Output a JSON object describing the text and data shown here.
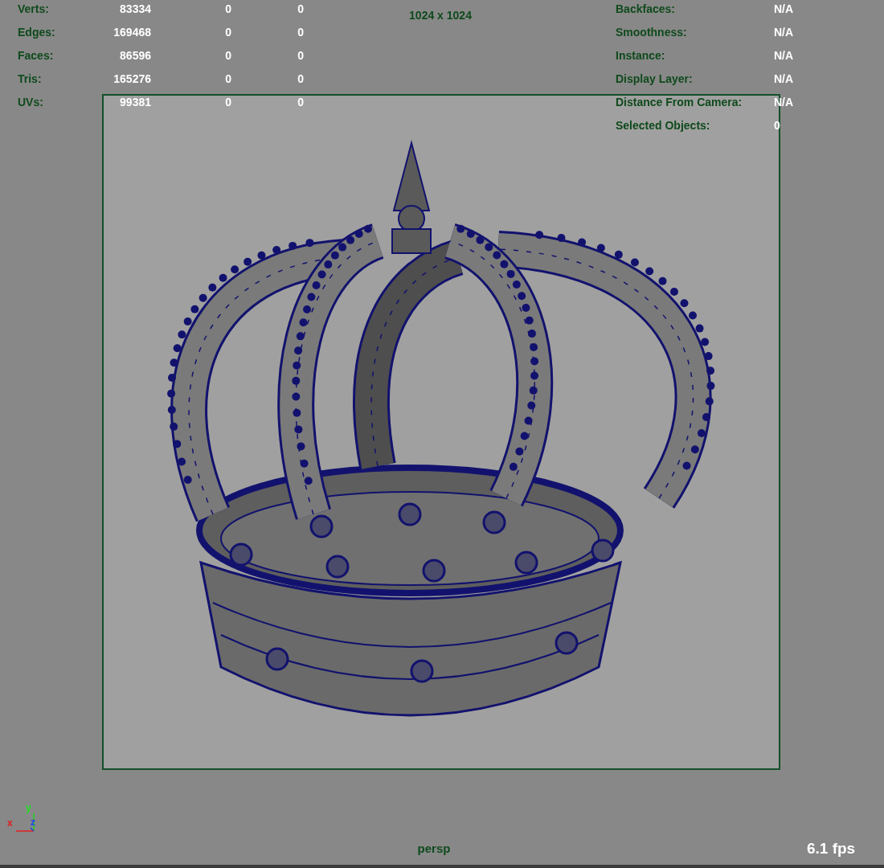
{
  "hud_left": {
    "rows": [
      {
        "label": "Verts:",
        "values": [
          "83334",
          "0",
          "0"
        ]
      },
      {
        "label": "Edges:",
        "values": [
          "169468",
          "0",
          "0"
        ]
      },
      {
        "label": "Faces:",
        "values": [
          "86596",
          "0",
          "0"
        ]
      },
      {
        "label": "Tris:",
        "values": [
          "165276",
          "0",
          "0"
        ]
      },
      {
        "label": "UVs:",
        "values": [
          "99381",
          "0",
          "0"
        ]
      }
    ]
  },
  "resolution": "1024 x 1024",
  "hud_right": {
    "rows": [
      {
        "label": "Backfaces:",
        "value": "N/A"
      },
      {
        "label": "Smoothness:",
        "value": "N/A"
      },
      {
        "label": "Instance:",
        "value": "N/A"
      },
      {
        "label": "Display Layer:",
        "value": "N/A"
      },
      {
        "label": "Distance From Camera:",
        "value": "N/A"
      },
      {
        "label": "Selected Objects:",
        "value": "0"
      }
    ]
  },
  "axis": {
    "x": "x",
    "y": "y",
    "z": "z"
  },
  "camera": "persp",
  "fps": "6.1 fps"
}
